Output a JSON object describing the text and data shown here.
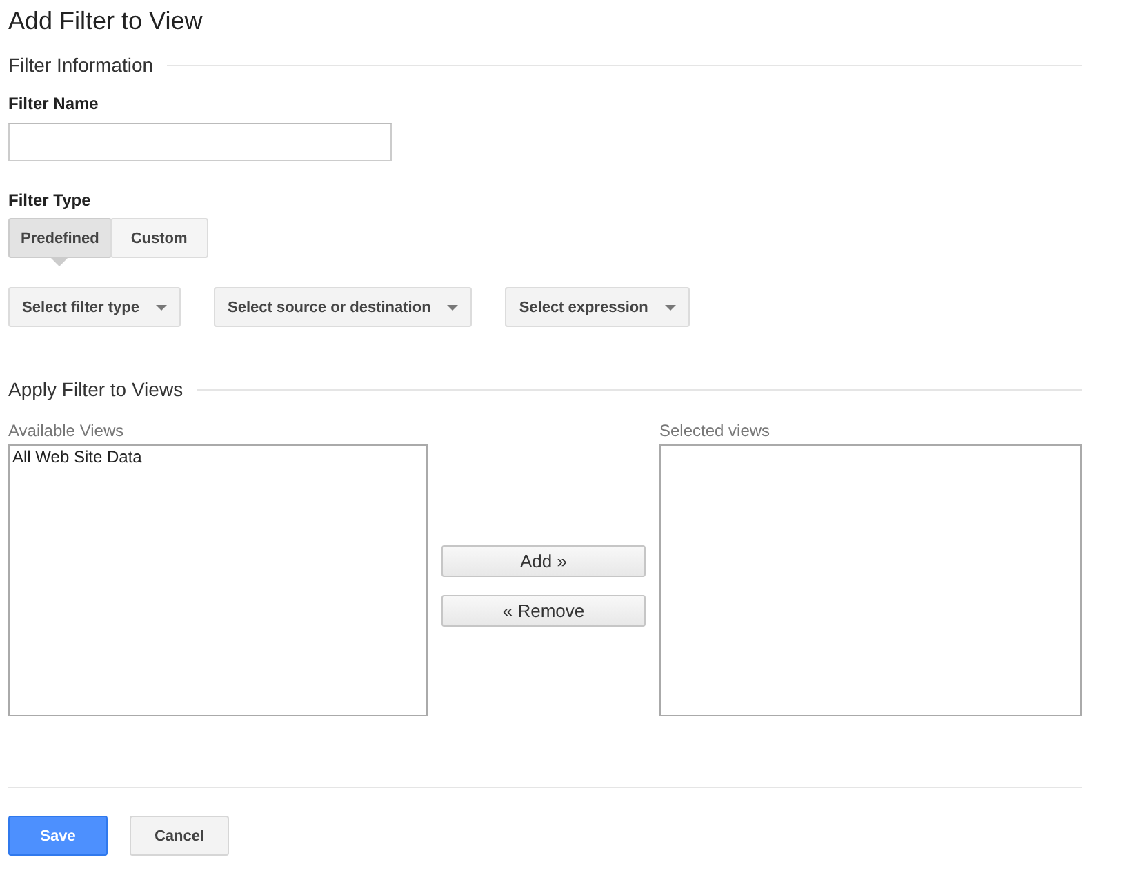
{
  "title": "Add Filter to View",
  "filter_information": {
    "heading": "Filter Information",
    "filter_name": {
      "label": "Filter Name"
    },
    "filter_type": {
      "label": "Filter Type",
      "tabs": [
        {
          "label": "Predefined",
          "selected": true
        },
        {
          "label": "Custom",
          "selected": false
        }
      ],
      "dropdowns": [
        "Select filter type",
        "Select source or destination",
        "Select expression"
      ]
    }
  },
  "apply_filter": {
    "heading": "Apply Filter to Views",
    "available": {
      "label": "Available Views",
      "items": [
        "All Web Site Data"
      ]
    },
    "buttons": [
      "Add »",
      "« Remove"
    ],
    "selected": {
      "label": "Selected views"
    }
  },
  "actions": [
    {
      "label": "Save",
      "kind": "primary"
    },
    {
      "label": "Cancel",
      "kind": "secondary"
    }
  ]
}
